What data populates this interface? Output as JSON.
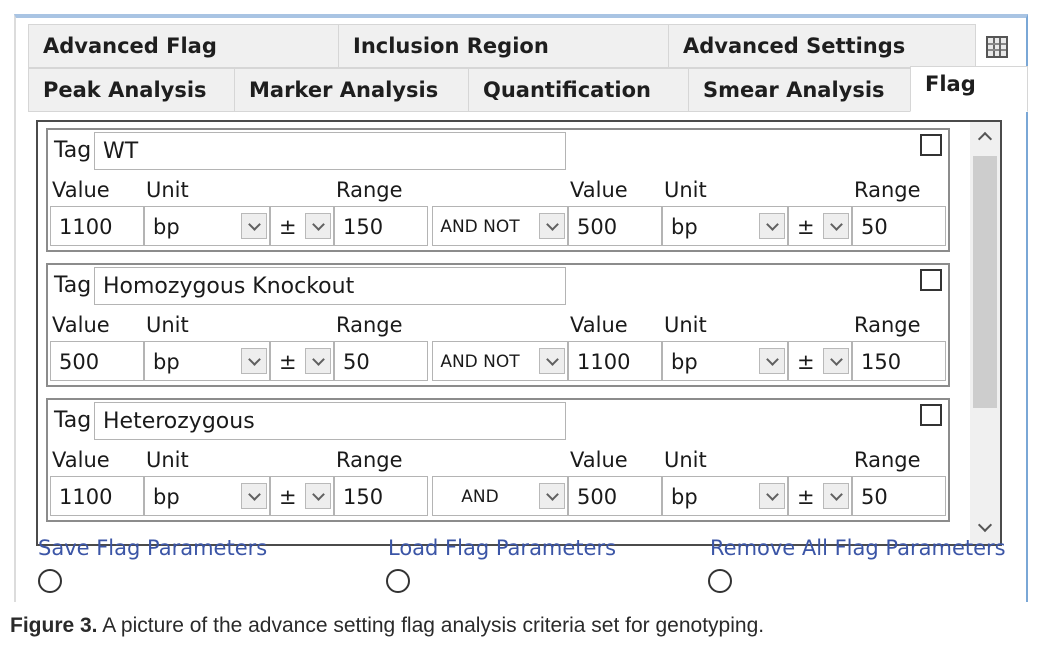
{
  "tabs_row1": [
    "Advanced Flag",
    "Inclusion Region",
    "Advanced Settings"
  ],
  "tabs_row2": [
    "Peak Analysis",
    "Marker Analysis",
    "Quantification",
    "Smear Analysis",
    "Flag"
  ],
  "active_tab": "Flag",
  "icons": {
    "columns": "grid-columns-icon"
  },
  "flag_groups": [
    {
      "tag_label": "Tag",
      "tag_value": "WT",
      "labels": {
        "value": "Value",
        "unit": "Unit",
        "range": "Range"
      },
      "value1": "1100",
      "unit1": "bp",
      "pm1": "±",
      "range1": "150",
      "logic": "AND NOT",
      "value2": "500",
      "unit2": "bp",
      "pm2": "±",
      "range2": "50"
    },
    {
      "tag_label": "Tag",
      "tag_value": "Homozygous Knockout",
      "labels": {
        "value": "Value",
        "unit": "Unit",
        "range": "Range"
      },
      "value1": "500",
      "unit1": "bp",
      "pm1": "±",
      "range1": "50",
      "logic": "AND NOT",
      "value2": "1100",
      "unit2": "bp",
      "pm2": "±",
      "range2": "150"
    },
    {
      "tag_label": "Tag",
      "tag_value": "Heterozygous",
      "labels": {
        "value": "Value",
        "unit": "Unit",
        "range": "Range"
      },
      "value1": "1100",
      "unit1": "bp",
      "pm1": "±",
      "range1": "150",
      "logic": "AND",
      "value2": "500",
      "unit2": "bp",
      "pm2": "±",
      "range2": "50"
    }
  ],
  "actions": {
    "save": "Save Flag Parameters",
    "load": "Load Flag Parameters",
    "remove": "Remove All Flag Parameters"
  },
  "caption": {
    "figure": "Figure 3.",
    "text": " A picture of the advance setting flag analysis criteria set for genotyping."
  }
}
